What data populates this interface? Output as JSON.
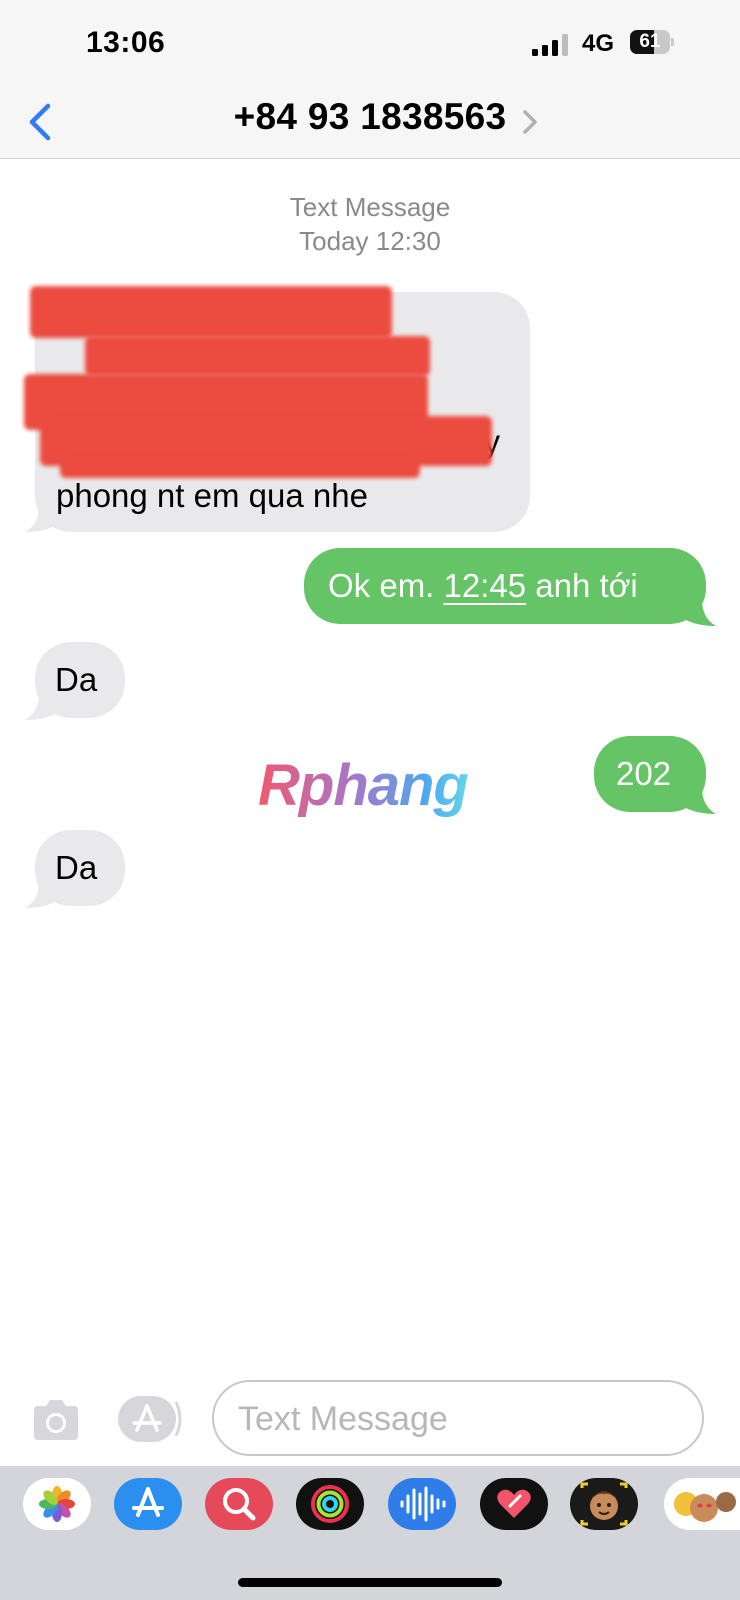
{
  "status": {
    "time": "13:06",
    "network": "4G",
    "battery": "61",
    "battery_level": 0.61
  },
  "header": {
    "contact": "+84 93 1838563"
  },
  "thread": {
    "service": "Text Message",
    "timestamp": "Today 12:30",
    "messages": [
      {
        "from": "them",
        "text": "phong nt em qua nhe",
        "redacted_fragment": "y"
      },
      {
        "from": "me",
        "pre": "Ok em. ",
        "link": "12:45",
        "post": " anh tới"
      },
      {
        "from": "them",
        "text": "Da"
      },
      {
        "from": "me",
        "text": "202"
      },
      {
        "from": "them",
        "text": "Da"
      }
    ]
  },
  "watermark": "Rphang",
  "composer": {
    "placeholder": "Text Message"
  },
  "app_drawer": [
    "photos-icon",
    "app-store-icon",
    "image-search-icon",
    "activity-icon",
    "audio-message-icon",
    "digital-touch-icon",
    "memoji-icon",
    "memoji-stickers-icon"
  ],
  "colors": {
    "incoming": "#e9e9eb",
    "outgoing": "#65c466",
    "accent": "#2f7cf6"
  }
}
